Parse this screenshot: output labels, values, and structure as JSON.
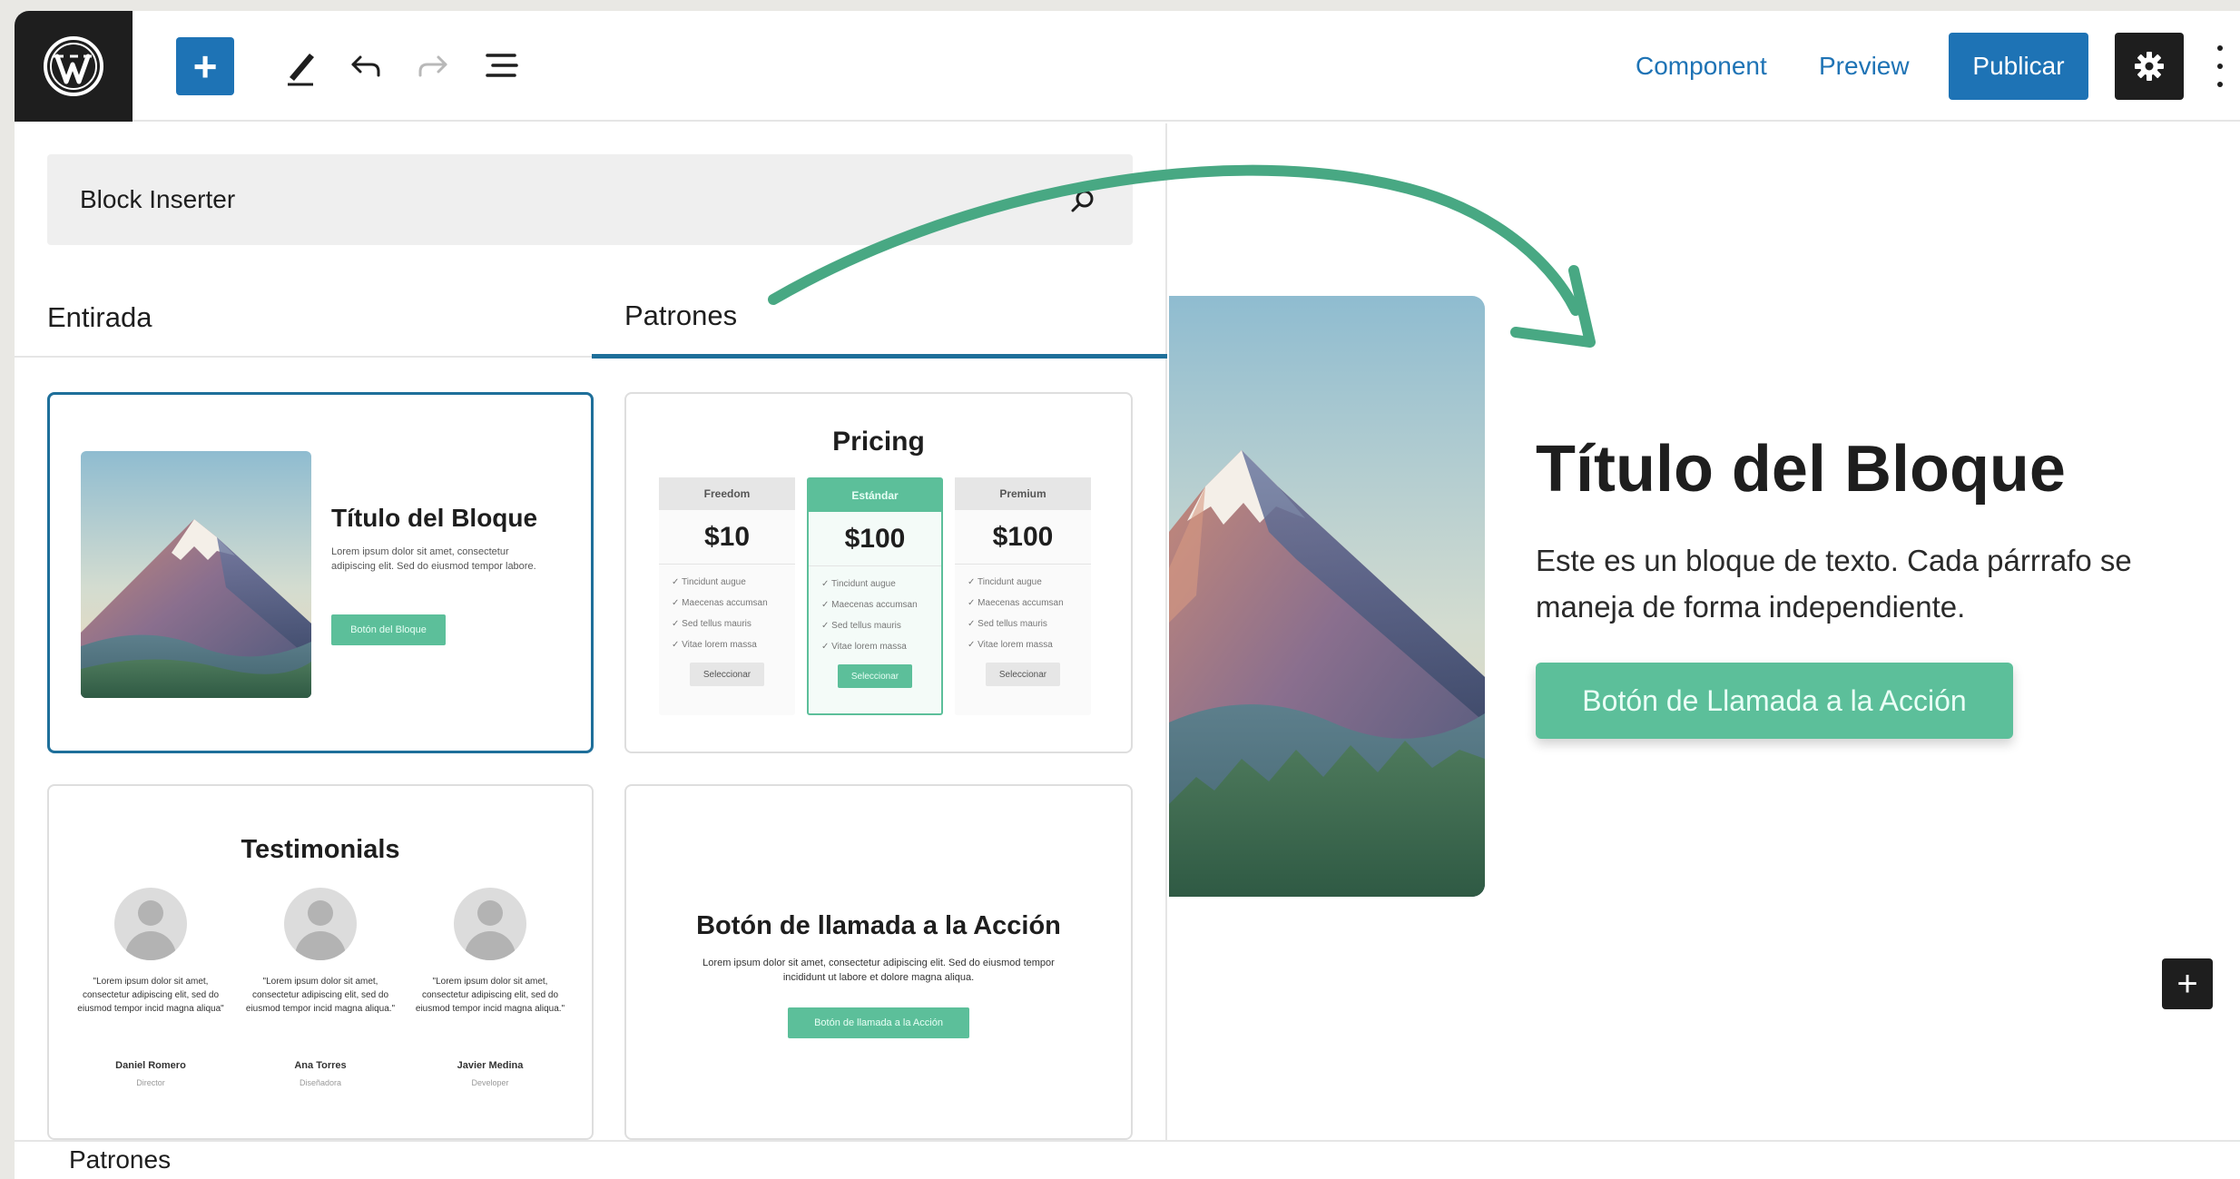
{
  "toolbar": {
    "add_block_symbol": "+",
    "component_link": "Component",
    "preview_link": "Preview",
    "publish_button": "Publicar"
  },
  "inserter": {
    "title": "Block Inserter",
    "tabs": [
      "Entirada",
      "Patrones"
    ],
    "active_tab": "Patrones"
  },
  "patterns": {
    "hero": {
      "title": "Título del Bloque",
      "text": "Lorem ipsum dolor sit amet, consectetur adipiscing elit. Sed do eiusmod tempor labore.",
      "button": "Botón del Bloque"
    },
    "pricing": {
      "title": "Pricing",
      "columns": [
        {
          "name": "Freedom",
          "price": "$10",
          "features": [
            "Tincidunt augue",
            "Maecenas accumsan",
            "Sed tellus mauris",
            "Vitae lorem massa"
          ],
          "button": "Seleccionar",
          "featured": false
        },
        {
          "name": "Estándar",
          "price": "$100",
          "features": [
            "Tincidunt augue",
            "Maecenas accumsan",
            "Sed tellus mauris",
            "Vitae lorem massa"
          ],
          "button": "Seleccionar",
          "featured": true
        },
        {
          "name": "Premium",
          "price": "$100",
          "features": [
            "Tincidunt augue",
            "Maecenas accumsan",
            "Sed tellus mauris",
            "Vitae lorem massa"
          ],
          "button": "Seleccionar",
          "featured": false
        }
      ]
    },
    "testimonials": {
      "title": "Testimonials",
      "items": [
        {
          "quote": "\"Lorem ipsum dolor sit amet, consectetur adipiscing elit, sed do eiusmod tempor incid magna aliqua\"",
          "name": "Daniel Romero",
          "role": "Director"
        },
        {
          "quote": "\"Lorem ipsum dolor sit amet, consectetur adipiscing elit, sed do eiusmod tempor incid magna aliqua.\"",
          "name": "Ana Torres",
          "role": "Diseñadora"
        },
        {
          "quote": "\"Lorem ipsum dolor sit amet, consectetur adipiscing elit, sed do eiusmod tempor incid magna aliqua.\"",
          "name": "Javier Medina",
          "role": "Developer"
        }
      ]
    },
    "cta": {
      "title": "Botón de llamada a la Acción",
      "text": "Lorem ipsum dolor sit amet, consectetur adipiscing elit. Sed do eiusmod tempor incididunt ut labore et dolore magna aliqua.",
      "button": "Botón de llamada a la Acción"
    }
  },
  "canvas": {
    "heading": "Título del Bloque",
    "paragraph": "Este es un bloque de texto. Cada párrrafo se maneja de forma independiente.",
    "button": "Botón de Llamada a la Acción",
    "add_symbol": "+"
  },
  "footer": {
    "label": "Patrones"
  },
  "colors": {
    "accent": "#1e73b5",
    "tab_underline": "#1e6f9a",
    "button_green": "#5cbf9a",
    "arrow": "#48a883",
    "dark": "#1e1e1e"
  }
}
